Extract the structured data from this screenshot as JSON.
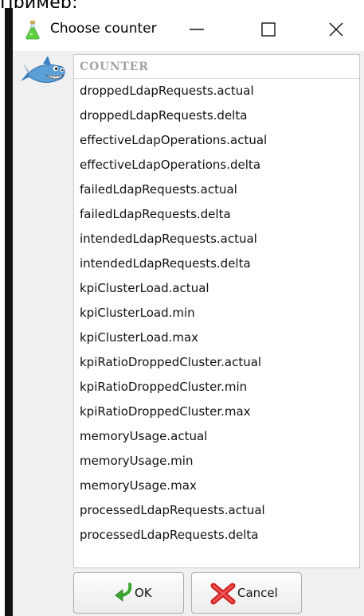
{
  "page": {
    "top_text": "Пример:"
  },
  "window": {
    "title": "Choose counter",
    "app_icon": "flask-icon",
    "controls": [
      "minimize-icon",
      "maximize-icon",
      "close-icon"
    ]
  },
  "mascot": {
    "icon": "shark-mascot-icon"
  },
  "list": {
    "header": "COUNTER",
    "items": [
      "droppedLdapRequests.actual",
      "droppedLdapRequests.delta",
      "effectiveLdapOperations.actual",
      "effectiveLdapOperations.delta",
      "failedLdapRequests.actual",
      "failedLdapRequests.delta",
      "intendedLdapRequests.actual",
      "intendedLdapRequests.delta",
      "kpiClusterLoad.actual",
      "kpiClusterLoad.min",
      "kpiClusterLoad.max",
      "kpiRatioDroppedCluster.actual",
      "kpiRatioDroppedCluster.min",
      "kpiRatioDroppedCluster.max",
      "memoryUsage.actual",
      "memoryUsage.min",
      "memoryUsage.max",
      "processedLdapRequests.actual",
      "processedLdapRequests.delta"
    ]
  },
  "buttons": {
    "ok_label": "OK",
    "ok_icon": "green-check-arrow-icon",
    "cancel_label": "Cancel",
    "cancel_icon": "red-x-icon"
  },
  "colors": {
    "header_text": "#a3a3a3",
    "window_bg": "#f0f0f0",
    "left_frame": "#111111"
  }
}
